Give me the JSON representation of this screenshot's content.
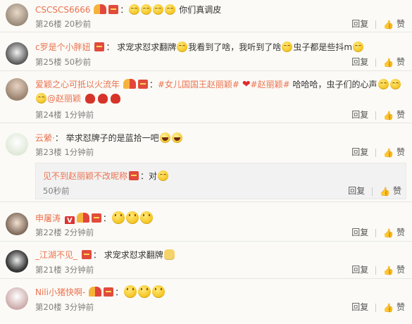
{
  "comments": [
    {
      "user": "CSCSCS6666",
      "text_after": "你们真调皮",
      "floor": "第26楼",
      "time": "20秒前"
    },
    {
      "user": "c罗是个小胖妞",
      "text_a": "求宠求怼求翻牌",
      "text_b": "我看到了啥，我听到了啥",
      "text_c": "虫子都是些抖m",
      "floor": "第25楼",
      "time": "50秒前"
    },
    {
      "user": "爱颖之心可抵以火流年",
      "topic1": "#女儿国国王赵丽颖#",
      "topic2": "#赵丽颖#",
      "text_a": "哈哈哈，虫子们的心声",
      "mention": "@赵丽颖",
      "floor": "第24楼",
      "time": "1分钟前"
    },
    {
      "user": "云縈·",
      "text_a": "举求怼牌子的是蓝拾一吧",
      "floor": "第23楼",
      "time": "1分钟前",
      "reply": {
        "user": "见不到赵丽颖不改昵称",
        "text": "对",
        "time": "50秒前"
      }
    },
    {
      "user": "申屠涛",
      "floor": "第22楼",
      "time": "2分钟前"
    },
    {
      "user": "_江湖不见_",
      "text_a": "求宠求怼求翻牌",
      "floor": "第21楼",
      "time": "3分钟前"
    },
    {
      "user": "Nili小猪快啊-",
      "floor": "第20楼",
      "time": "3分钟前"
    }
  ],
  "actions": {
    "reply": "回复",
    "like": "赞"
  },
  "colors": {
    "username": "#eb7350",
    "background": "#fbfaf6"
  }
}
